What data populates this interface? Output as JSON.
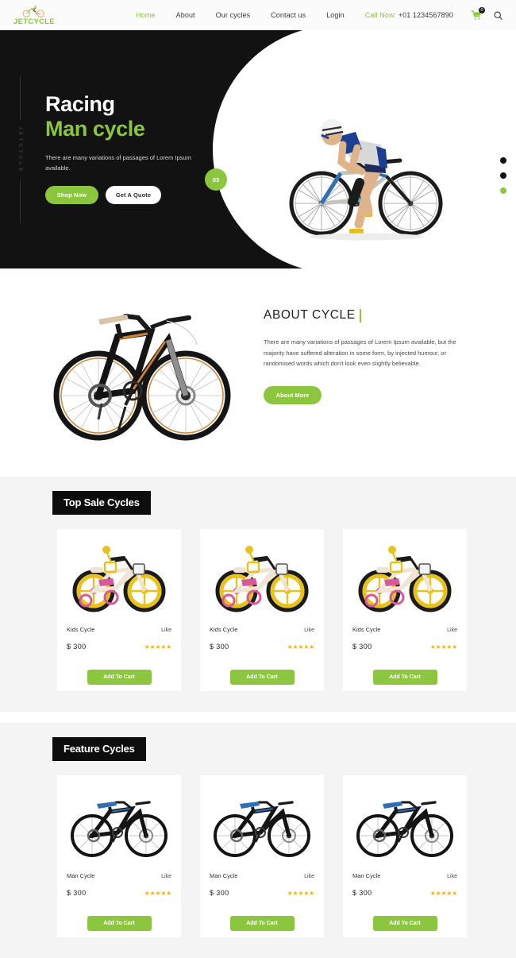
{
  "header": {
    "brand": {
      "name": "JETCYCLE",
      "icon": "bicycle-logo-icon"
    },
    "nav": [
      {
        "label": "Home",
        "active": true
      },
      {
        "label": "About",
        "active": false
      },
      {
        "label": "Our cycles",
        "active": false
      },
      {
        "label": "Contact us",
        "active": false
      },
      {
        "label": "Login",
        "active": false
      }
    ],
    "call_now_label": "Call Now:",
    "phone": "+01 1234567890",
    "cart_count": "0",
    "cart_icon": "shopping-cart-icon",
    "search_icon": "search-icon"
  },
  "hero": {
    "vertical_text": "JETCYCLE",
    "title_line1": "Racing",
    "title_line2": "Man cycle",
    "description": "There are many variations of passages of Lorem Ipsum available.",
    "primary_button": "Shop Now",
    "secondary_button": "Get A Quote",
    "slide_number": "03",
    "figure": "racing-cyclist-photo",
    "dots": [
      {
        "active": false
      },
      {
        "active": false
      },
      {
        "active": true
      }
    ]
  },
  "about": {
    "image": "mountain-bike-photo",
    "title": "ABOUT CYCLE",
    "text": "There are many variations of passages of Lorem Ipsum available, but the majority have suffered alteration in some form, by injected humour, or randomised words which don't look even slightly believable.",
    "button": "About More"
  },
  "sections": [
    {
      "heading": "Top Sale Cycles",
      "products": [
        {
          "name": "Kids Cycle",
          "like": "Like",
          "price": "$ 300",
          "stars": "★★★★★",
          "cart": "Add To Cart",
          "image": "kids-bicycle-photo"
        },
        {
          "name": "Kids Cycle",
          "like": "Like",
          "price": "$ 300",
          "stars": "★★★★★",
          "cart": "Add To Cart",
          "image": "kids-bicycle-photo"
        },
        {
          "name": "Kids Cycle",
          "like": "Like",
          "price": "$ 300",
          "stars": "★★★★★",
          "cart": "Add To Cart",
          "image": "kids-bicycle-photo"
        }
      ]
    },
    {
      "heading": "Feature Cycles",
      "products": [
        {
          "name": "Man Cycle",
          "like": "Like",
          "price": "$ 300",
          "stars": "★★★★★",
          "cart": "Add To Cart",
          "image": "man-bicycle-photo"
        },
        {
          "name": "Man Cycle",
          "like": "Like",
          "price": "$ 300",
          "stars": "★★★★★",
          "cart": "Add To Cart",
          "image": "man-bicycle-photo"
        },
        {
          "name": "Man Cycle",
          "like": "Like",
          "price": "$ 300",
          "stars": "★★★★★",
          "cart": "Add To Cart",
          "image": "man-bicycle-photo"
        }
      ]
    }
  ],
  "colors": {
    "accent_green": "#8cc63e",
    "dark": "#121212",
    "star_gold": "#f4b400",
    "section_bg": "#f4f4f4"
  }
}
